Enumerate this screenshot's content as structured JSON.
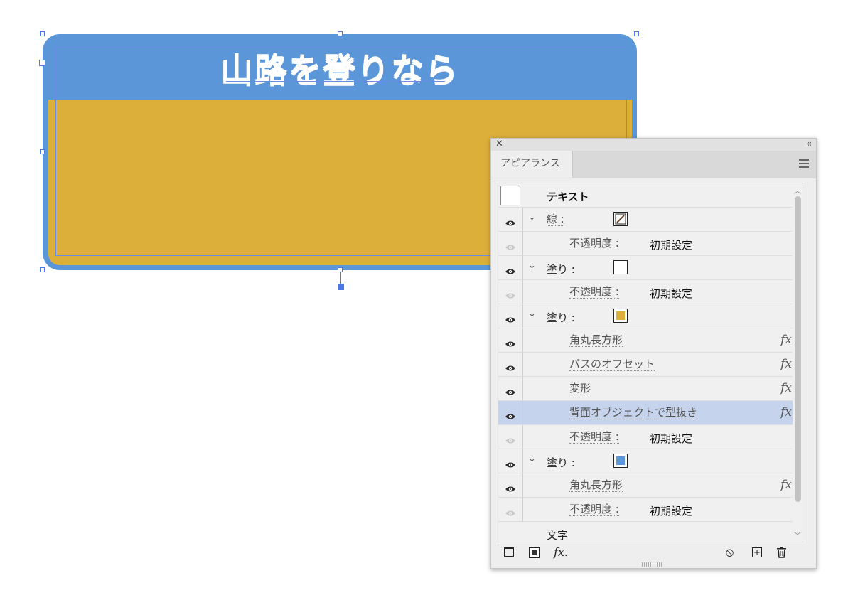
{
  "artwork": {
    "title": "山路を登りなら",
    "colors": {
      "outer": "#5b96d9",
      "fill": "#dcaf3b",
      "selection": "#4a78e6"
    }
  },
  "panel": {
    "tab_label": "アピアランス",
    "close_icon": "close-icon",
    "collapse_icon": "collapse-icon",
    "menu_icon": "panel-menu-icon",
    "rows": [
      {
        "label": "テキスト"
      },
      {
        "label": "線 :",
        "swatch": "stroke-swatch"
      },
      {
        "label": "不透明度 :",
        "value": "初期設定"
      },
      {
        "label": "塗り :",
        "swatch_color": "#ffffff"
      },
      {
        "label": "不透明度 :",
        "value": "初期設定"
      },
      {
        "label": "塗り :",
        "swatch_color": "#dcaf3b"
      },
      {
        "label": "角丸長方形",
        "fx": "fx"
      },
      {
        "label": "パスのオフセット",
        "fx": "fx"
      },
      {
        "label": "変形",
        "fx": "fx"
      },
      {
        "label": "背面オブジェクトで型抜き",
        "fx": "fx",
        "selected": true
      },
      {
        "label": "不透明度 :",
        "value": "初期設定"
      },
      {
        "label": "塗り :",
        "swatch_color": "#5b96d9"
      },
      {
        "label": "角丸長方形",
        "fx": "fx"
      },
      {
        "label": "不透明度 :",
        "value": "初期設定"
      },
      {
        "label": "文字"
      }
    ],
    "footer": {
      "add_stroke": "add-new-stroke-icon",
      "add_fill": "add-new-fill-icon",
      "fx_label": "fx.",
      "clear": "clear-appearance-icon",
      "duplicate": "duplicate-item-icon",
      "delete": "trash-icon"
    }
  }
}
